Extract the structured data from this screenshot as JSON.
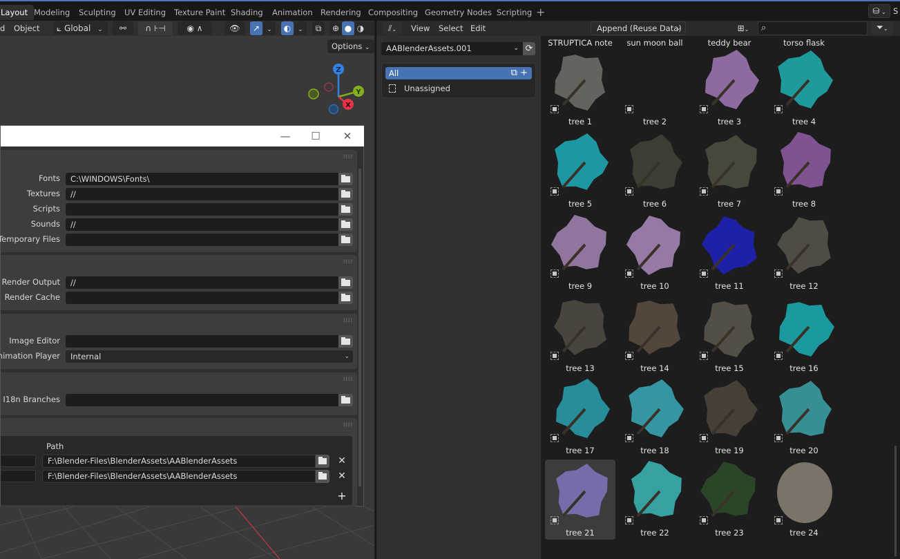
{
  "workspace_tabs": [
    "Layout",
    "Modeling",
    "Sculpting",
    "UV Editing",
    "Texture Paint",
    "Shading",
    "Animation",
    "Rendering",
    "Compositing",
    "Geometry Nodes",
    "Scripting"
  ],
  "active_workspace": "Layout",
  "add_workspace_label": "+",
  "scene": {
    "icon": "scene-icon",
    "label": "S"
  },
  "viewport": {
    "menu_partial": "d",
    "mode_label": "Object",
    "transform_orientation": "Global",
    "options_label": "Options",
    "gizmo_axes": {
      "x": "X",
      "y": "Y",
      "z": "Z"
    },
    "colors": {
      "x": "#e2354a",
      "y": "#83b01e",
      "z": "#2f82e6"
    }
  },
  "preferences": {
    "window_controls": {
      "minimize": "—",
      "maximize": "☐",
      "close": "✕"
    },
    "data_paths": [
      {
        "label": "Fonts",
        "value": "C:\\WINDOWS\\Fonts\\"
      },
      {
        "label": "Textures",
        "value": "//"
      },
      {
        "label": "Scripts",
        "value": ""
      },
      {
        "label": "Sounds",
        "value": "//"
      },
      {
        "label": "Temporary Files",
        "value": ""
      }
    ],
    "render_paths": [
      {
        "label": "Render Output",
        "value": "//"
      },
      {
        "label": "Render Cache",
        "value": ""
      }
    ],
    "applications": [
      {
        "label": "Image Editor",
        "value": ""
      },
      {
        "label": "Animation Player",
        "value": "Internal"
      }
    ],
    "development": [
      {
        "label": "I18n Branches",
        "value": ""
      }
    ],
    "asset_libraries": {
      "path_header": "Path",
      "rows": [
        {
          "name": "",
          "path": "F:\\Blender-Files\\BlenderAssets\\AABlenderAssets"
        },
        {
          "name": "",
          "path": "F:\\Blender-Files\\BlenderAssets\\AABlenderAssets"
        }
      ],
      "add_label": "+",
      "remove_label": "✕"
    }
  },
  "asset_browser": {
    "menus": [
      "View",
      "Select",
      "Edit"
    ],
    "import_method": "Append (Reuse Data)",
    "search_placeholder": "",
    "library": "AABlenderAssets.001",
    "catalogs": [
      {
        "label": "All",
        "active": true
      },
      {
        "label": "Unassigned",
        "active": false
      }
    ],
    "top_row_labels": [
      "STRUPTICA note",
      "sun moon ball",
      "teddy bear",
      "torso flask"
    ],
    "assets": [
      {
        "name": "tree 1",
        "color": "#6e6c68",
        "selected": false
      },
      {
        "name": "tree 2",
        "color": "",
        "selected": false
      },
      {
        "name": "tree 3",
        "color": "#9a74b0",
        "selected": false
      },
      {
        "name": "tree 4",
        "color": "#1fa8ab",
        "selected": false
      },
      {
        "name": "tree 5",
        "color": "#1ea5b0",
        "selected": false
      },
      {
        "name": "tree 6",
        "color": "#3f4236",
        "selected": false
      },
      {
        "name": "tree 7",
        "color": "#4e4c3f",
        "selected": false
      },
      {
        "name": "tree 8",
        "color": "#8b5aa0",
        "selected": false
      },
      {
        "name": "tree 9",
        "color": "#9d7fae",
        "selected": false
      },
      {
        "name": "tree 10",
        "color": "#a584b5",
        "selected": false
      },
      {
        "name": "tree 11",
        "color": "#1d22b8",
        "selected": false
      },
      {
        "name": "tree 12",
        "color": "#55524a",
        "selected": false
      },
      {
        "name": "tree 13",
        "color": "#4e4a42",
        "selected": false
      },
      {
        "name": "tree 14",
        "color": "#5a4d40",
        "selected": false
      },
      {
        "name": "tree 15",
        "color": "#5a554c",
        "selected": false
      },
      {
        "name": "tree 16",
        "color": "#1ca7ae",
        "selected": false
      },
      {
        "name": "tree 17",
        "color": "#2a9aa8",
        "selected": false
      },
      {
        "name": "tree 18",
        "color": "#3aa3b2",
        "selected": false
      },
      {
        "name": "tree 19",
        "color": "#4a4438",
        "selected": false
      },
      {
        "name": "tree 20",
        "color": "#3a9ca2",
        "selected": false
      },
      {
        "name": "tree 21",
        "color": "#7a72b5",
        "selected": true
      },
      {
        "name": "tree 22",
        "color": "#3ab0b0",
        "selected": false
      },
      {
        "name": "tree 23",
        "color": "#2e4a2a",
        "selected": false
      },
      {
        "name": "tree 24",
        "color": "#7a7468",
        "selected": false
      }
    ]
  }
}
